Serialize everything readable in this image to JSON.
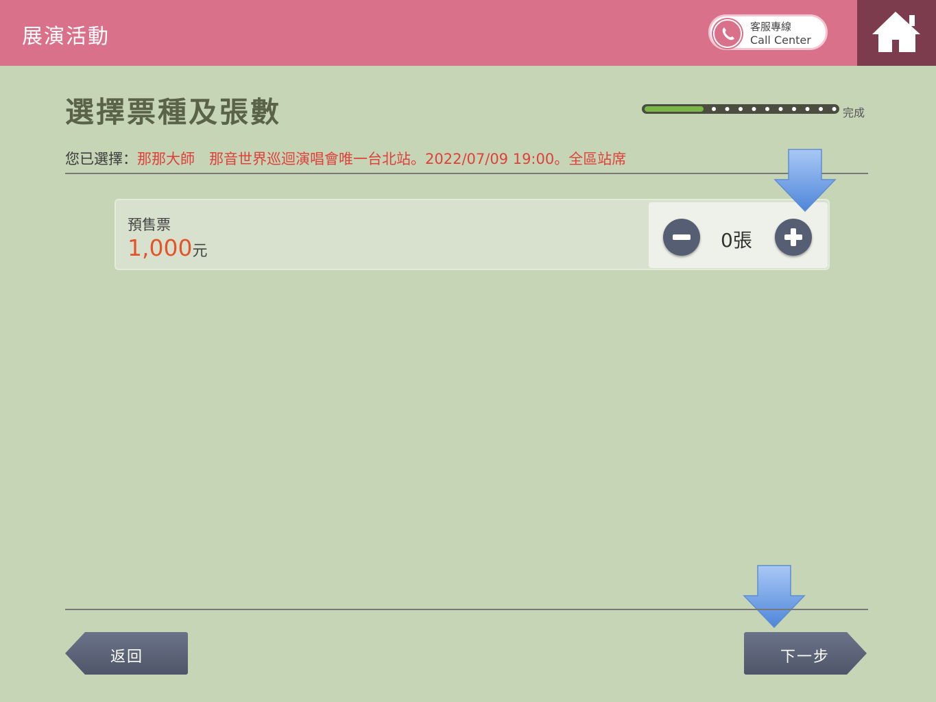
{
  "header": {
    "title": "展演活動",
    "call_center_zh": "客服專線",
    "call_center_en": "Call Center"
  },
  "page": {
    "title": "選擇票種及張數",
    "progress_done_label": "完成",
    "progress_fraction": 0.1
  },
  "selection": {
    "label": "您已選擇：",
    "value": "那那大師　那音世界巡迴演唱會唯一台北站。2022/07/09 19:00。全區站席"
  },
  "tickets": [
    {
      "name": "預售票",
      "price": "1,000",
      "price_unit": "元",
      "quantity": "0",
      "quantity_unit": "張"
    }
  ],
  "nav": {
    "back_label": "返回",
    "next_label": "下一步"
  },
  "colors": {
    "header": "#d9718a",
    "home_box": "#7d3c4e",
    "background": "#c5d5b6",
    "price": "#e4532a",
    "button": "#555e73",
    "progress": "#7ab648"
  },
  "icons": {
    "call": "phone-icon",
    "home": "home-icon",
    "minus": "minus-icon",
    "plus": "plus-icon",
    "hint": "down-arrow-icon"
  }
}
